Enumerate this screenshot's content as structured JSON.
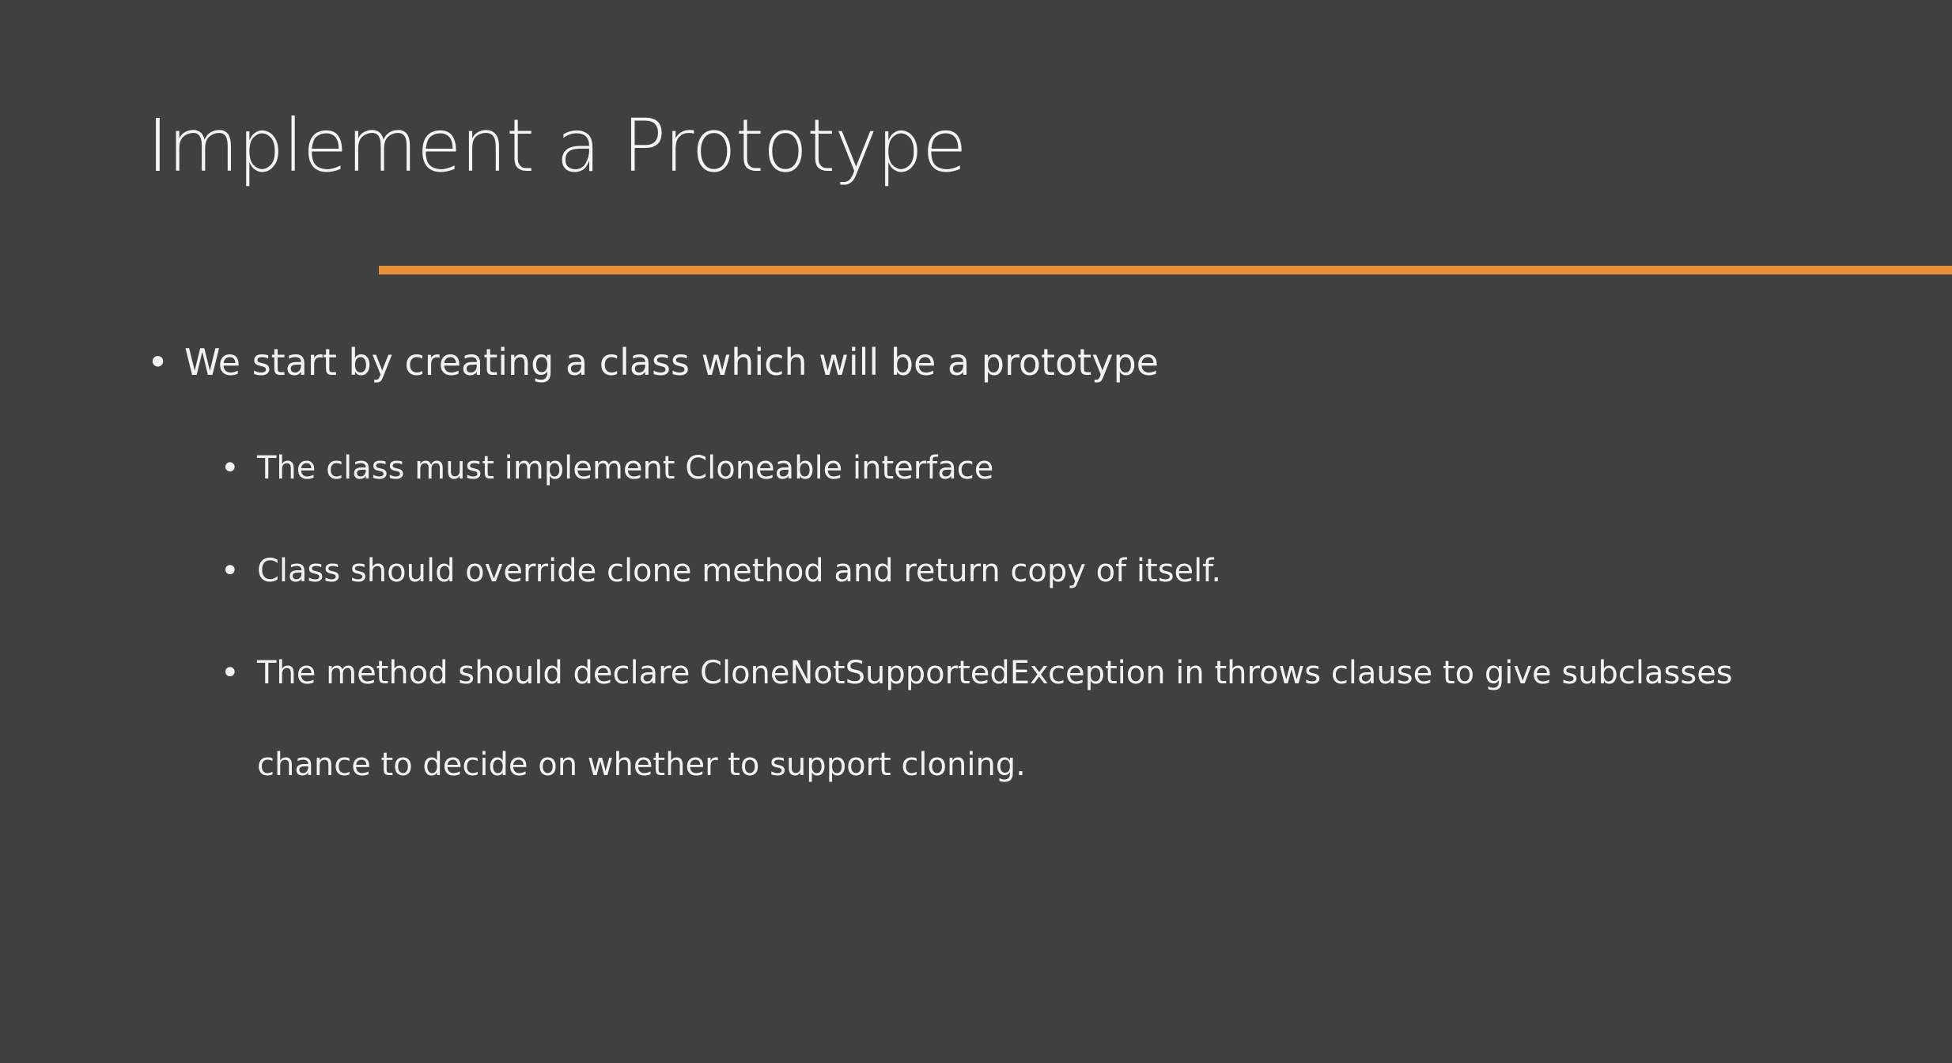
{
  "slide": {
    "title": "Implement a Prototype",
    "accent_color": "#e69138",
    "background_color": "#404040",
    "bullet_glyph": "•",
    "bullets": [
      {
        "level": 1,
        "text": "We start by creating a class which will be a prototype"
      },
      {
        "level": 2,
        "text": "The class must implement Cloneable interface"
      },
      {
        "level": 2,
        "text": "Class should override clone method and return copy of itself."
      },
      {
        "level": 2,
        "lines": [
          "The method should declare CloneNotSupportedException in throws clause to give subclasses",
          "chance to decide on whether to support cloning."
        ]
      }
    ]
  }
}
